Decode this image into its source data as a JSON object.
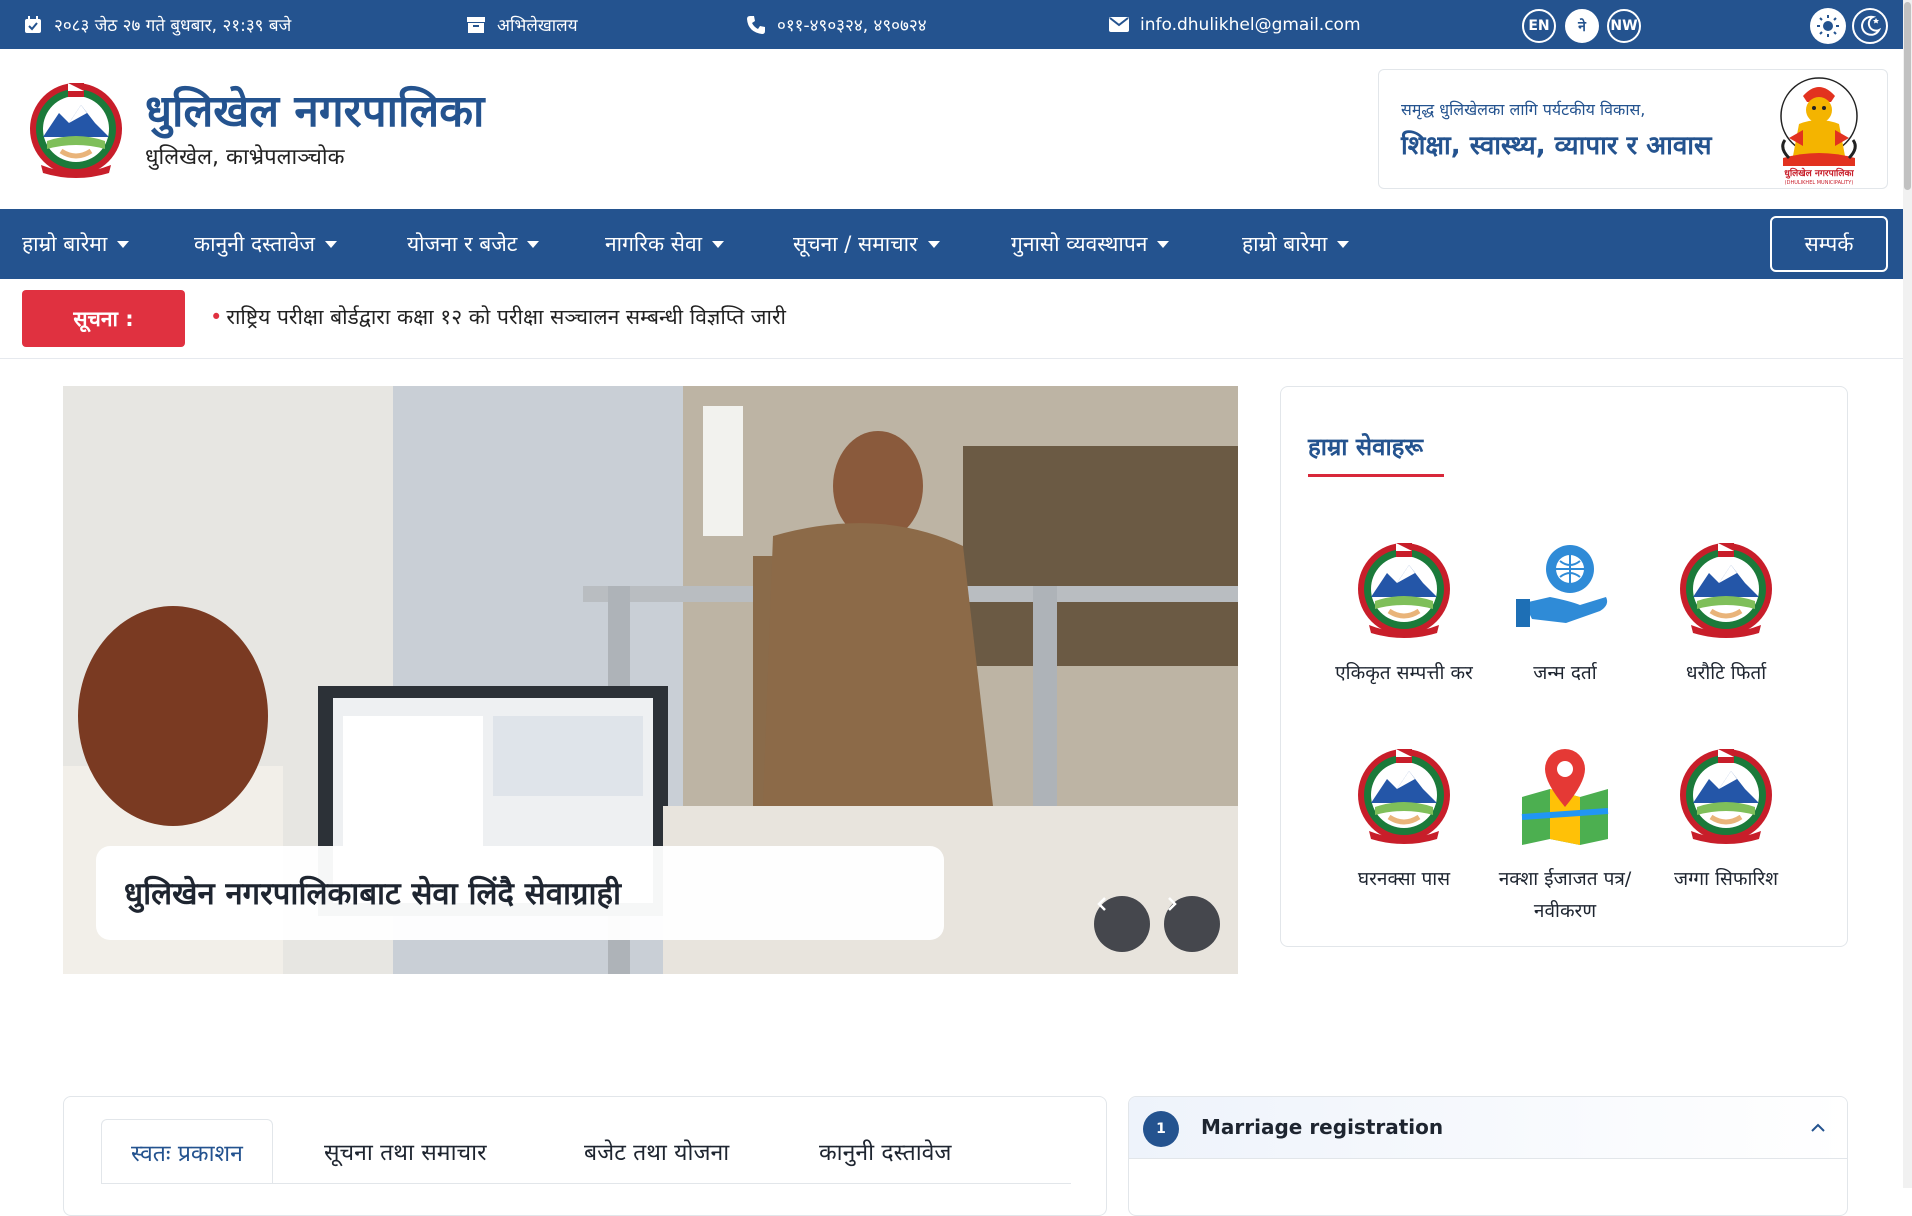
{
  "topbar": {
    "datetime": "२०८३ जेठ २७ गते बुधबार, २१:३९ बजे",
    "archive": "अभिलेखालय",
    "phone": "०११-४९०३२४, ४९०७२४",
    "email": "info.dhulikhel@gmail.com",
    "languages": [
      "EN",
      "ने",
      "NW"
    ]
  },
  "header": {
    "title": "धुलिखेल नगरपालिका",
    "subtitle": "धुलिखेल, काभ्रेपलाञ्चोक",
    "slogan_small": "समृद्ध धुलिखेलका लागि पर्यटकीय विकास,",
    "slogan_big": "शिक्षा, स्वास्थ्य, व्यापार र आवास",
    "deity_caption": "धुलिखेल नगरपालिका",
    "deity_caption_en": "(DHULIKHEL MUNICIPALITY)"
  },
  "nav": {
    "items": [
      "हाम्रो बारेमा",
      "कानुनी दस्तावेज",
      "योजना र बजेट",
      "नागरिक सेवा",
      "सूचना / समाचार",
      "गुनासो व्यवस्थापन",
      "हाम्रो बारेमा"
    ],
    "contact": "सम्पर्क"
  },
  "notice": {
    "label": "सूचना :",
    "text": "राष्ट्रिय परीक्षा बोर्डद्वारा कक्षा १२ को परीक्षा सञ्चालन सम्बन्धी विज्ञप्ति जारी"
  },
  "slider": {
    "caption": "धुलिखेन नगरपालिकाबाट सेवा लिंदै सेवाग्राही"
  },
  "services": {
    "title": "हाम्रा सेवाहरू",
    "items": [
      {
        "label": "एकिकृत सम्पत्ती कर",
        "icon": "emblem-icon"
      },
      {
        "label": "जन्म दर्ता",
        "icon": "globe-hand-icon"
      },
      {
        "label": "धरौटि फिर्ता",
        "icon": "emblem-icon"
      },
      {
        "label": "घरनक्सा पास",
        "icon": "emblem-icon"
      },
      {
        "label": "नक्शा ईजाजत पत्र/नवीकरण",
        "icon": "map-pin-icon"
      },
      {
        "label": "जग्गा सिफारिश",
        "icon": "emblem-icon"
      }
    ]
  },
  "tabs": [
    "स्वतः प्रकाशन",
    "सूचना तथा समाचार",
    "बजेट तथा योजना",
    "कानुनी दस्तावेज"
  ],
  "accordion": {
    "number": "1",
    "title": "Marriage registration"
  },
  "colors": {
    "primary": "#24538f",
    "accent_red": "#e03140"
  }
}
